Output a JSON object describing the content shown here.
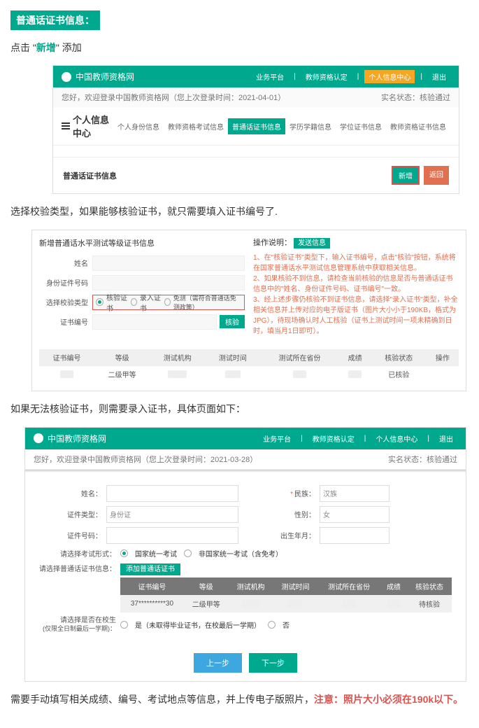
{
  "section_title": "普通话证书信息：",
  "para1_pre": "点击 \"",
  "para1_action": "新增",
  "para1_post": "\" 添加",
  "ss1": {
    "brand": "中国教师资格网",
    "nav": {
      "a": "业务平台",
      "b": "教师资格认定",
      "c": "个人信息中心",
      "d": "退出"
    },
    "welcome": "您好，欢迎登录中国教师资格网（您上次登录时间：2021-04-01）",
    "realname_label": "实名状态：",
    "realname_value": "核验通过",
    "center_title": "个人信息中心",
    "tabs": {
      "t1": "个人身份信息",
      "t2": "教师资格考试信息",
      "t3": "普通话证书信息",
      "t4": "学历学籍信息",
      "t5": "学位证书信息",
      "t6": "教师资格证书信息"
    },
    "panel_title": "普通话证书信息",
    "btn_new": "新增",
    "btn_back": "返回"
  },
  "para2": "选择校验类型，如果能够核验证书，就只需要填入证书编号了.",
  "ss2": {
    "form_title": "新增普通话水平测试等级证书信息",
    "labels": {
      "name": "姓名",
      "idcard": "身份证件号码",
      "verify_type": "选择校验类型",
      "cert_no": "证书编号"
    },
    "radio_verify": "核验证书",
    "radio_enter": "录入证书",
    "radio_free": "免测（需符合普通话免测政策）",
    "btn_verify": "核验",
    "inst_title": "操作说明：",
    "btn_send": "发送信息",
    "inst_1": "1、在\"核验证书\"类型下，输入证书编号，点击\"核验\"按钮，系统将在国家普通话水平测试信息管理系统中获取相关信息。",
    "inst_2": "2、如果核验不到信息，请检查当前核验的信息是否与普通话证书信息中的\"姓名、身份证件号码、证书编号\"一致。",
    "inst_3": "3、经上述步骤仍核验不到证书信息，请选择\"录入证书\"类型，补全相关信息并上传对应的电子版证书（图片大小小于190KB，格式为JPG），待现场确认时人工核验（证书上测试时间一项未精确到日时，填当月1日即可）。",
    "table": {
      "h1": "证书编号",
      "h2": "等级",
      "h3": "测试机构",
      "h4": "测试时间",
      "h5": "测试所在省份",
      "h6": "成绩",
      "h7": "核验状态",
      "h8": "操作",
      "r_level": "二级甲等",
      "r_status": "已核验"
    }
  },
  "para3": "如果无法核验证书，则需要录入证书，具体页面如下：",
  "ss3": {
    "brand": "中国教师资格网",
    "nav": {
      "a": "业务平台",
      "b": "教师资格认定",
      "c": "个人信息中心",
      "d": "退出"
    },
    "welcome": "您好，欢迎登录中国教师资格网（您上次登录时间：2021-03-28）",
    "realname_label": "实名状态：",
    "realname_value": "核验通过",
    "labels": {
      "name": "姓名：",
      "nation": "民族：",
      "nation_val": "汉族",
      "cert_type": "证件类型：",
      "cert_type_val": "身份证",
      "gender": "性别：",
      "gender_val": "女",
      "cert_no": "证件号码：",
      "birth": "出生年月：",
      "exam_form": "请选择考试形式：",
      "exam_opt1": "国家统一考试",
      "exam_opt2": "非国家统一考试（含免考）",
      "select_cert": "请选择普通话证书信息：",
      "btn_add": "添加普通话证书",
      "in_school": "请选择是否在校生",
      "in_school_sub": "(仅限全日制最后一学期)：",
      "yes_opt": "是（未取得毕业证书，在校最后一学期）",
      "no_opt": "否"
    },
    "table": {
      "h1": "证书编号",
      "h2": "等级",
      "h3": "测试机构",
      "h4": "测试时间",
      "h5": "测试所在省份",
      "h6": "成绩",
      "h7": "核验状态",
      "r_no": "37**********30",
      "r_level": "二级甲等",
      "r_status": "待核验"
    },
    "btn_prev": "上一步",
    "btn_next": "下一步"
  },
  "para4_a": "需要手动填写相关成绩、编号、考试地点等信息，并上传电子版照片，",
  "para4_b": "注意：照片大小必须在190k以下。"
}
